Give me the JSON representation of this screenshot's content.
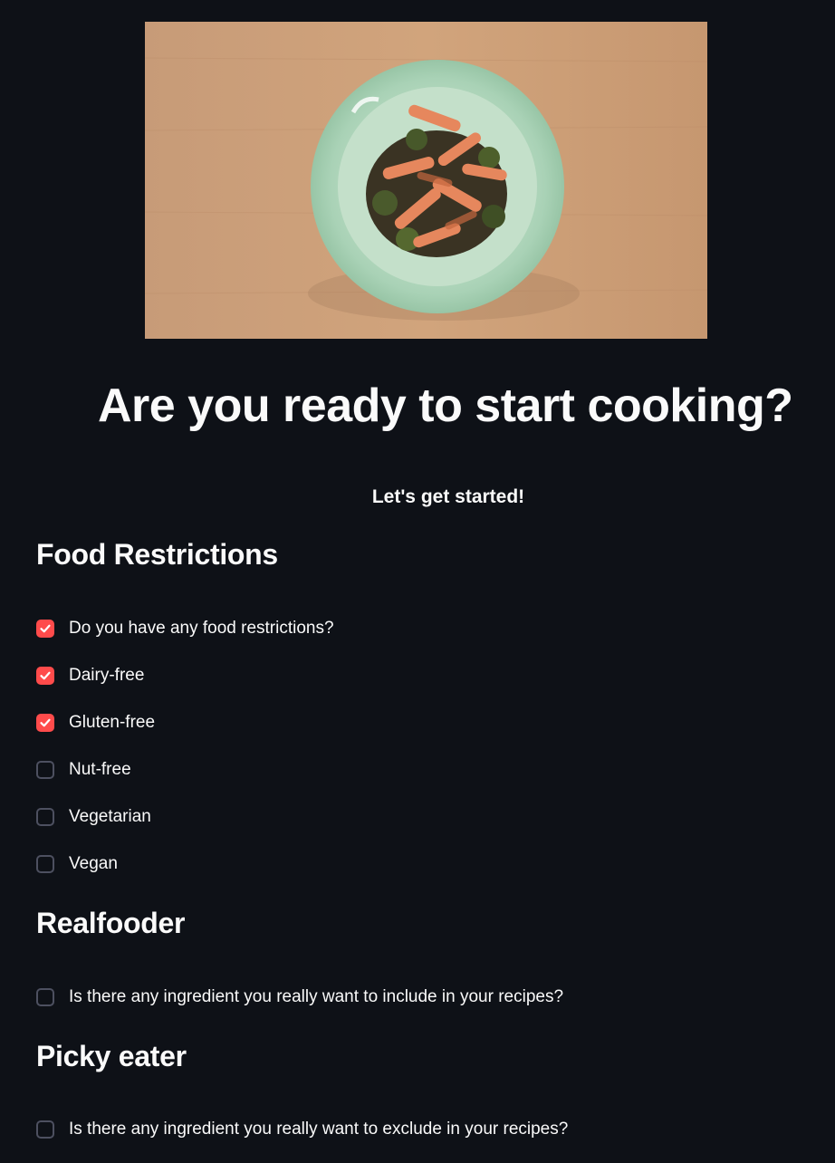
{
  "hero": {
    "image_alt": "plate of stir-fried chicken with broccoli on a wooden table"
  },
  "title": "Are you ready to start cooking?",
  "subtitle": "Let's get started!",
  "sections": {
    "food_restrictions": {
      "heading": "Food Restrictions",
      "options": [
        {
          "label": "Do you have any food restrictions?",
          "checked": true
        },
        {
          "label": "Dairy-free",
          "checked": true
        },
        {
          "label": "Gluten-free",
          "checked": true
        },
        {
          "label": "Nut-free",
          "checked": false
        },
        {
          "label": "Vegetarian",
          "checked": false
        },
        {
          "label": "Vegan",
          "checked": false
        }
      ]
    },
    "realfooder": {
      "heading": "Realfooder",
      "options": [
        {
          "label": "Is there any ingredient you really want to include in your recipes?",
          "checked": false
        }
      ]
    },
    "picky_eater": {
      "heading": "Picky eater",
      "options": [
        {
          "label": "Is there any ingredient you really want to exclude in your recipes?",
          "checked": false
        }
      ]
    }
  },
  "colors": {
    "background": "#0e1117",
    "accent": "#ff4b4b",
    "text": "#fafafa",
    "checkbox_border": "#4d5060"
  },
  "icons": {
    "checkbox_checked": "check-icon"
  }
}
